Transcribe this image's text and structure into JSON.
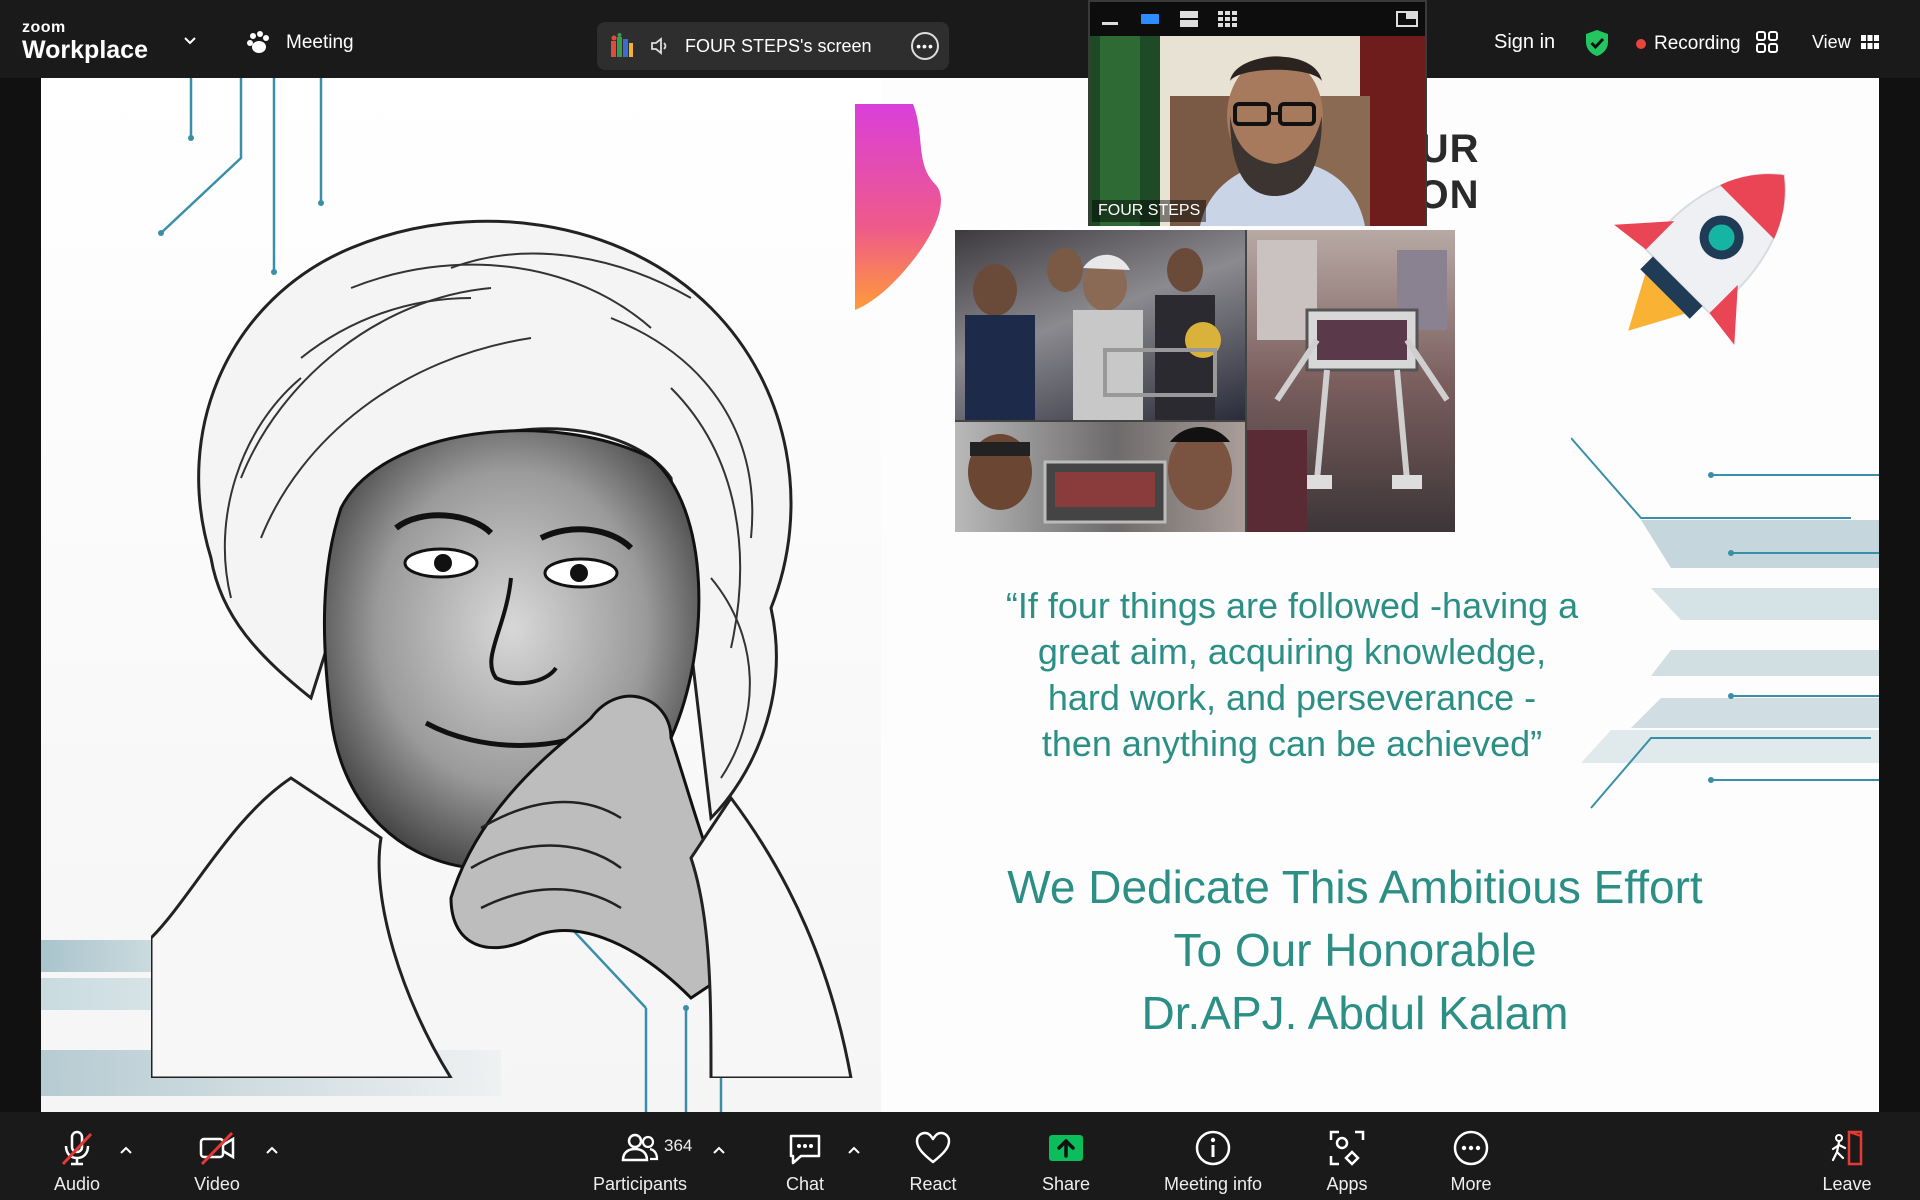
{
  "app": {
    "brand_small": "zoom",
    "brand_big": "Workplace"
  },
  "topbar": {
    "meeting_label": "Meeting",
    "share_label": "FOUR STEPS's screen",
    "sign_in": "Sign in",
    "recording_label": "Recording",
    "view_label": "View",
    "accent_green": "#22c55e",
    "recording_color": "#e8453c"
  },
  "slide": {
    "title_line1": "OUR",
    "title_line2": "ATION",
    "quote_line1": "“If four things are followed -having a",
    "quote_line2": "great aim, acquiring knowledge,",
    "quote_line3": "hard work, and perseverance -",
    "quote_line4": "then anything can be achieved”",
    "dedication_line1": "We Dedicate This Ambitious Effort",
    "dedication_line2": "To Our Honorable",
    "dedication_line3": "Dr.APJ. Abdul Kalam",
    "text_color": "#2c8f86"
  },
  "video": {
    "participant_name": "FOUR STEPS"
  },
  "toolbar": {
    "audio": "Audio",
    "video": "Video",
    "participants": "Participants",
    "participant_count": "364",
    "chat": "Chat",
    "react": "React",
    "share": "Share",
    "meeting_info": "Meeting info",
    "apps": "Apps",
    "more": "More",
    "leave": "Leave",
    "share_color": "#0bbd5b",
    "leave_color": "#e53935"
  }
}
